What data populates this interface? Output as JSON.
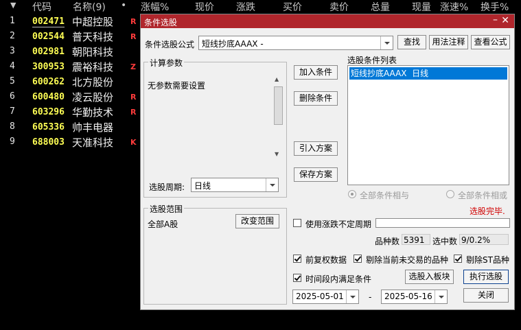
{
  "header": {
    "arrow": "▼",
    "cols": [
      "代码",
      "名称(9)",
      "•",
      "涨幅%",
      "现价",
      "涨跌",
      "买价",
      "卖价",
      "总量",
      "现量",
      "涨速%",
      "换手%"
    ]
  },
  "rows": [
    {
      "idx": "1",
      "code": "002471",
      "name": "中超控股",
      "tag": "R"
    },
    {
      "idx": "2",
      "code": "002544",
      "name": "普天科技",
      "tag": "R"
    },
    {
      "idx": "3",
      "code": "002981",
      "name": "朝阳科技",
      "tag": ""
    },
    {
      "idx": "4",
      "code": "300953",
      "name": "震裕科技",
      "tag": "Z"
    },
    {
      "idx": "5",
      "code": "600262",
      "name": "北方股份",
      "tag": ""
    },
    {
      "idx": "6",
      "code": "600480",
      "name": "凌云股份",
      "tag": "R"
    },
    {
      "idx": "7",
      "code": "603296",
      "name": "华勤技术",
      "tag": "R"
    },
    {
      "idx": "8",
      "code": "605336",
      "name": "帅丰电器",
      "tag": ""
    },
    {
      "idx": "9",
      "code": "688003",
      "name": "天准科技",
      "tag": "K"
    }
  ],
  "dialog": {
    "title": "条件选股",
    "minimize": "–",
    "close": "✕",
    "formula_label": "条件选股公式",
    "formula_value": "短线抄底AAAX -",
    "find_btn": "查找",
    "usage_btn": "用法注释",
    "view_formula_btn": "查看公式",
    "params_group": "计算参数",
    "params_text": "无参数需要设置",
    "period_label": "选股周期:",
    "period_value": "日线",
    "add_cond_btn": "加入条件",
    "del_cond_btn": "删除条件",
    "import_btn": "引入方案",
    "save_btn": "保存方案",
    "cond_list_label": "选股条件列表",
    "cond_items": [
      "短线抄底AAAX  日线"
    ],
    "radio_and": "全部条件相与",
    "radio_or": "全部条件相或",
    "status": "选股完毕.",
    "scope_group": "选股范围",
    "scope_value": "全部A股",
    "change_scope_btn": "改变范围",
    "uncertain_period_label": "使用涨跌不定周期",
    "count_label": "品种数",
    "count_value": "5391",
    "selected_label": "选中数",
    "selected_value": "9/0.2%",
    "cb_pre_adjust": "前复权数据",
    "cb_exclude_untraded": "剔除当前未交易的品种",
    "cb_exclude_st": "剔除ST品种",
    "cb_time_range": "时间段内满足条件",
    "to_block_btn": "选股入板块",
    "execute_btn": "执行选股",
    "date_from": "2025-05-01",
    "date_sep": "-",
    "date_to": "2025-05-16",
    "close_btn": "关闭"
  },
  "colors": {
    "title_bar": "#b0262c",
    "code": "#ffff55",
    "tag": "#ff3b3b",
    "selection": "#0078d7",
    "status": "#d00000"
  }
}
